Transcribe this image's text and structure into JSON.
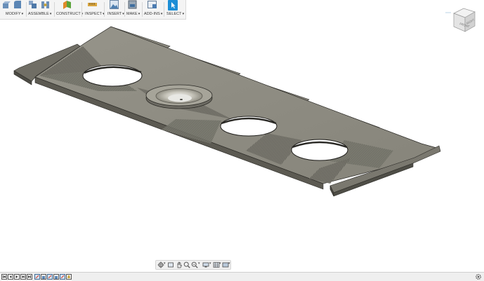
{
  "toolbar": {
    "groups": [
      {
        "label": "MODIFY",
        "icons": [
          "press-pull-icon",
          "fillet-icon"
        ]
      },
      {
        "label": "ASSEMBLE",
        "icons": [
          "new-component-icon",
          "joint-icon"
        ]
      },
      {
        "label": "CONSTRUCT",
        "icons": [
          "offset-plane-icon"
        ]
      },
      {
        "label": "INSPECT",
        "icons": [
          "measure-icon"
        ]
      },
      {
        "label": "INSERT",
        "icons": [
          "insert-image-icon"
        ]
      },
      {
        "label": "MAKE",
        "icons": [
          "3d-print-icon"
        ]
      },
      {
        "label": "ADD-INS",
        "icons": [
          "scripts-icon"
        ]
      },
      {
        "label": "SELECT",
        "icons": [
          "select-cursor-icon"
        ]
      }
    ],
    "dropdown_caret": "▾"
  },
  "viewcube": {
    "face_label": "FRONT",
    "corner_label": "RIGHT"
  },
  "navigation_bar": {
    "items": [
      "orbit-icon",
      "look-at-icon",
      "pan-icon",
      "zoom-icon",
      "zoom-window-icon",
      "display-settings-icon",
      "grid-settings-icon",
      "viewports-icon"
    ]
  },
  "timeline": {
    "controls": [
      "go-to-start-icon",
      "step-back-icon",
      "play-icon",
      "step-forward-icon",
      "go-to-end-icon"
    ],
    "features": [
      "sketch-feature-icon",
      "extrude-feature-icon",
      "sketch-feature-icon",
      "extrude-feature-icon",
      "sketch-feature-icon",
      "loft-feature-icon"
    ],
    "settings_icon": "gear-icon"
  },
  "colors": {
    "model_top": "#8c8a80",
    "model_side": "#5f5d55",
    "model_dark": "#3f3e38",
    "hole": "#ffffff",
    "toolbar_bg": "#f4f4f4",
    "select_accent": "#1c8ed6"
  }
}
